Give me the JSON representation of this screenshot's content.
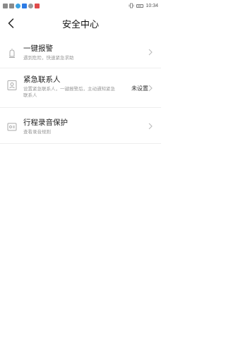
{
  "statusbar": {
    "time": "10:34"
  },
  "header": {
    "title": "安全中心"
  },
  "rows": [
    {
      "title": "一键报警",
      "subtitle": "遇到危险，快速紧急求助",
      "status": ""
    },
    {
      "title": "紧急联系人",
      "subtitle_line1": "设置紧急联系人，一键报警后，主动通知紧急",
      "subtitle_line2": "联系人",
      "status": "未设置"
    },
    {
      "title": "行程录音保护",
      "subtitle": "查看录音规则",
      "status": ""
    }
  ]
}
